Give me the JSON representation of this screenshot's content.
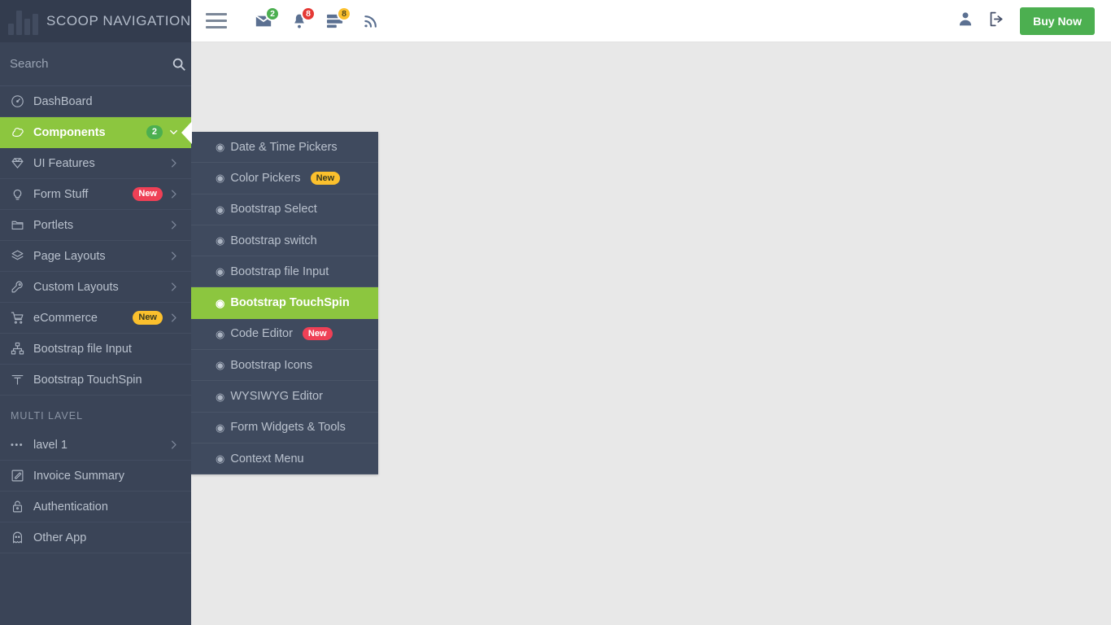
{
  "brand": {
    "title": "SCOOP NAVIGATION",
    "logo_icon": "bar-chart-icon"
  },
  "search": {
    "placeholder": "Search",
    "value": "",
    "icon": "search-icon"
  },
  "topbar": {
    "hamburger_icon": "hamburger-icon",
    "icons": [
      {
        "name": "envelope-icon",
        "badge": "2",
        "badge_color": "#4caf50"
      },
      {
        "name": "bell-icon",
        "badge": "8",
        "badge_color": "#e53935"
      },
      {
        "name": "tasks-icon",
        "badge": "8",
        "badge_color": "#fbc02d"
      },
      {
        "name": "rss-icon",
        "badge": "",
        "badge_color": ""
      }
    ],
    "user_icon": "user-icon",
    "logout_icon": "logout-icon",
    "buy_label": "Buy Now",
    "buy_color": "#4caf50"
  },
  "sidebar": {
    "items": [
      {
        "label": "DashBoard",
        "icon": "speedometer-icon",
        "badge": "",
        "badge_style": "",
        "arrow": "",
        "active": false
      },
      {
        "label": "Components",
        "icon": "puzzle-icon",
        "badge": "2",
        "badge_style": "green",
        "arrow": "chevron-down-icon",
        "active": true
      },
      {
        "label": "UI Features",
        "icon": "diamond-icon",
        "badge": "",
        "badge_style": "",
        "arrow": "chevron-right-icon",
        "active": false
      },
      {
        "label": "Form Stuff",
        "icon": "lightbulb-icon",
        "badge": "New",
        "badge_style": "red",
        "arrow": "chevron-right-icon",
        "active": false
      },
      {
        "label": "Portlets",
        "icon": "folder-icon",
        "badge": "",
        "badge_style": "",
        "arrow": "chevron-right-icon",
        "active": false
      },
      {
        "label": "Page Layouts",
        "icon": "layers-icon",
        "badge": "",
        "badge_style": "",
        "arrow": "chevron-right-icon",
        "active": false
      },
      {
        "label": "Custom Layouts",
        "icon": "wrench-icon",
        "badge": "",
        "badge_style": "",
        "arrow": "chevron-right-icon",
        "active": false
      },
      {
        "label": "eCommerce",
        "icon": "cart-icon",
        "badge": "New",
        "badge_style": "yellow",
        "arrow": "chevron-right-icon",
        "active": false
      },
      {
        "label": "Bootstrap file Input",
        "icon": "sitemap-icon",
        "badge": "",
        "badge_style": "",
        "arrow": "",
        "active": false
      },
      {
        "label": "Bootstrap TouchSpin",
        "icon": "touchspin-icon",
        "badge": "",
        "badge_style": "",
        "arrow": "",
        "active": false
      }
    ],
    "section_heading": "MULTI LAVEL",
    "multi_items": [
      {
        "label": "lavel 1",
        "icon": "dots-icon",
        "badge": "",
        "badge_style": "",
        "arrow": "chevron-right-icon",
        "active": false
      },
      {
        "label": "Invoice Summary",
        "icon": "edit-square-icon",
        "badge": "",
        "badge_style": "",
        "arrow": "",
        "active": false
      },
      {
        "label": "Authentication",
        "icon": "lock-icon",
        "badge": "",
        "badge_style": "",
        "arrow": "",
        "active": false
      },
      {
        "label": "Other App",
        "icon": "ghost-icon",
        "badge": "",
        "badge_style": "",
        "arrow": "",
        "active": false
      }
    ]
  },
  "submenu": {
    "bullet": "◉",
    "items": [
      {
        "label": "Date & Time Pickers",
        "badge": "",
        "badge_style": "",
        "active": false
      },
      {
        "label": "Color Pickers",
        "badge": "New",
        "badge_style": "yellow",
        "active": false
      },
      {
        "label": "Bootstrap Select",
        "badge": "",
        "badge_style": "",
        "active": false
      },
      {
        "label": "Bootstrap switch",
        "badge": "",
        "badge_style": "",
        "active": false
      },
      {
        "label": "Bootstrap file Input",
        "badge": "",
        "badge_style": "",
        "active": false
      },
      {
        "label": "Bootstrap TouchSpin",
        "badge": "",
        "badge_style": "",
        "active": true
      },
      {
        "label": "Code Editor",
        "badge": "New",
        "badge_style": "red",
        "active": false
      },
      {
        "label": "Bootstrap Icons",
        "badge": "",
        "badge_style": "",
        "active": false
      },
      {
        "label": "WYSIWYG Editor",
        "badge": "",
        "badge_style": "",
        "active": false
      },
      {
        "label": "Form Widgets & Tools",
        "badge": "",
        "badge_style": "",
        "active": false
      },
      {
        "label": "Context Menu",
        "badge": "",
        "badge_style": "",
        "active": false
      }
    ]
  },
  "colors": {
    "sidebar_bg": "#3a4457",
    "submenu_bg": "#3f4a5e",
    "accent_green": "#8cc63f",
    "content_bg": "#e8e8e8",
    "topbar_bg": "#ffffff"
  }
}
